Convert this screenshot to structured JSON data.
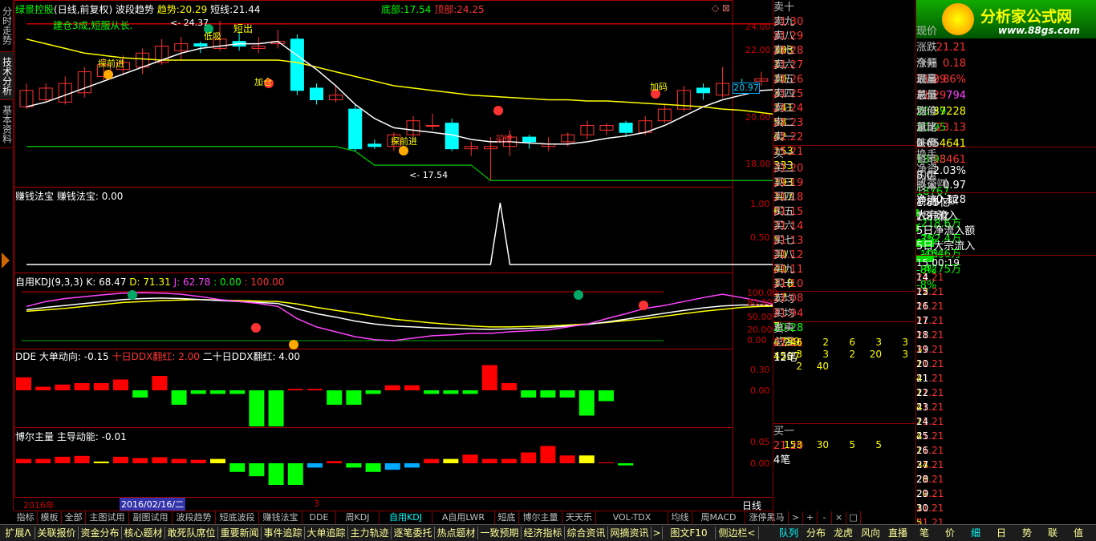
{
  "left_tabs": [
    "分时走势",
    "技术分析",
    "基本资料"
  ],
  "main": {
    "title_stock": "绿景控股",
    "title_mode": "(日线,前复权)",
    "title_ind": "波段趋势",
    "trend_label": "趋势:",
    "trend_val": "20.29",
    "short_label": "短线:",
    "short_val": "21.44",
    "bottom_label": "底部:",
    "bottom_val": "17.54",
    "top_label": "顶部:",
    "top_val": "24.25",
    "note": "建仓3成,短服从长.",
    "high_mark": "24.37",
    "low_mark": "17.54",
    "sig_short_out": "短出",
    "sig_buy": "低吸",
    "sig_early_in": "探前进",
    "sig_early_in2": "探前进",
    "sig_add": "加仓",
    "sig_in2": "买进",
    "sig_dyn": "加码",
    "axis": [
      "24.00",
      "22.00",
      "20.00",
      "18.00"
    ],
    "price_marker": "20.97"
  },
  "zqfb": {
    "title": "赚钱法宝",
    "label": "赚钱法宝:",
    "val": "0.00",
    "axis": [
      "1.00",
      "0.50"
    ]
  },
  "kdj": {
    "title": "自用KDJ(9,3,3)",
    "k": "K: 68.47",
    "d": "D: 71.31",
    "j": "J: 62.78",
    "v1": ": 0.00",
    "v2": ": 100.00",
    "axis": [
      "100.00",
      "80.00",
      "50.00",
      "20.00",
      "0.00"
    ]
  },
  "dde": {
    "title": "DDE",
    "l1": "大单动向: -0.15",
    "l2": "十日DDX翻红: 2.00",
    "l3": "二十日DDX翻红: 4.00",
    "axis": [
      "0.30",
      "0.00"
    ]
  },
  "boer": {
    "title": "博尔主量",
    "l1": "主导动能: -0.01",
    "axis": [
      "0.05",
      "0.00"
    ]
  },
  "dates": {
    "d1": "2016年",
    "d2": "2016/02/16/二",
    "d3": "3",
    "period": "日线"
  },
  "asks": [
    {
      "label": "卖十",
      "price": "21.30",
      "vol": "183",
      "arrow": "⇞"
    },
    {
      "label": "卖九",
      "price": "21.29",
      "vol": "30"
    },
    {
      "label": "卖八",
      "price": "21.28",
      "vol": "11"
    },
    {
      "label": "卖七",
      "price": "21.27",
      "vol": "10"
    },
    {
      "label": "卖六",
      "price": "21.26",
      "vol": "3"
    },
    {
      "label": "卖五",
      "price": "21.25",
      "vol": "141"
    },
    {
      "label": "卖四",
      "price": "21.24",
      "vol": "58"
    },
    {
      "label": "卖三",
      "price": "21.23",
      "vol": "42"
    },
    {
      "label": "卖二",
      "price": "21.22",
      "vol": "153"
    },
    {
      "label": "卖一",
      "price": "21.21",
      "vol": "333"
    }
  ],
  "bids": [
    {
      "label": "买一",
      "price": "21.20",
      "vol": "193"
    },
    {
      "label": "买二",
      "price": "21.19",
      "vol": "107"
    },
    {
      "label": "买三",
      "price": "21.18",
      "vol": "61"
    },
    {
      "label": "买四",
      "price": "21.15",
      "vol": "21"
    },
    {
      "label": "买五",
      "price": "21.14",
      "vol": "5"
    },
    {
      "label": "买六",
      "price": "21.13",
      "vol": "20"
    },
    {
      "label": "买七",
      "price": "21.12",
      "vol": "40"
    },
    {
      "label": "买八",
      "price": "21.11",
      "vol": "118"
    },
    {
      "label": "买九",
      "price": "21.10",
      "vol": "17"
    },
    {
      "label": "买十",
      "price": "21.08",
      "vol": "7",
      "arrow": "⇟"
    }
  ],
  "avg": {
    "sell_avg_l": "卖均",
    "sell_avg": "21.94",
    "total_sell_l": "总卖",
    "total_sell": "4739",
    "buy_avg_l": "买均",
    "buy_avg": "20.28",
    "total_buy_l": "总买",
    "total_buy": "4507"
  },
  "sell1q": {
    "label": "卖一",
    "price": "21.21",
    "count": "12笔",
    "rows": [
      [
        "246",
        "2",
        "6",
        "3",
        "3"
      ],
      [
        "3",
        "3",
        "2",
        "20",
        "3"
      ],
      [
        "2",
        "40",
        "",
        "",
        ""
      ]
    ]
  },
  "buy1q": {
    "label": "买一",
    "price": "21.20",
    "count": "4笔",
    "rows": [
      [
        "153",
        "30",
        "5",
        "5"
      ]
    ]
  },
  "logo": {
    "text": "分析家公式网",
    "url": "www.88gs.com"
  },
  "info": [
    {
      "l": "现价",
      "v": "21.21",
      "l2": "今开",
      "v2": "21.29"
    },
    {
      "l": "涨跌",
      "v": "0.18",
      "l2": "最高",
      "v2": "21.29"
    },
    {
      "l": "涨幅",
      "v": "0.86%",
      "l2": "最低",
      "v2": "20.59"
    },
    {
      "l": "现量",
      "v": "794",
      "l2": "均价",
      "v2": "20.95"
    },
    {
      "l": "总量",
      "v": "37228",
      "l2": "量比",
      "v2": "0.65"
    },
    {
      "l": "涨停",
      "v": "23.13",
      "l2": "跌停",
      "v2": "18.93"
    },
    {
      "l": "总笔",
      "v": "4641",
      "l2": "每笔",
      "v2": "8.0"
    },
    {
      "l": "外盘",
      "v": "18461",
      "l2": "内盘",
      "v2": "18767"
    }
  ],
  "info2": [
    {
      "l": "换手",
      "v": "2.03%",
      "l2": "股本",
      "v2": "1.85亿"
    },
    {
      "l": "净资",
      "v": "0.97",
      "l2": "流通",
      "v2": "1.83亿"
    },
    {
      "l": "收益㈣",
      "v": "-0.128",
      "l2": "PE(动)",
      "v2": ""
    }
  ],
  "flow": [
    {
      "l": "净流入额",
      "v": "-218.6万",
      "p": "-3%"
    },
    {
      "l": "大宗流入",
      "v": "-752.4万",
      "p": "-10%"
    },
    {
      "l": "5日净流入额",
      "v": "-4646万",
      "p": "-8%"
    },
    {
      "l": "5日大宗流入",
      "v": "-4275万",
      "p": "-8%"
    }
  ],
  "ticks": [
    {
      "t": "15:00:19",
      "p": "21.21",
      "v": "22"
    },
    {
      "t": "14",
      "p": "21.21",
      "v": "2"
    },
    {
      "t": "15",
      "p": "21.21",
      "v": "1"
    },
    {
      "t": "16",
      "p": "21.21",
      "v": "1"
    },
    {
      "t": "17",
      "p": "21.21",
      "v": "3"
    },
    {
      "t": "18",
      "p": "21.21",
      "v": "1"
    },
    {
      "t": "19",
      "p": "21.21",
      "v": "4"
    },
    {
      "t": "20",
      "p": "21.21",
      "v": "1"
    },
    {
      "t": "21",
      "p": "21.21",
      "v": "4"
    },
    {
      "t": "22",
      "p": "21.21",
      "v": "1"
    },
    {
      "t": "23",
      "p": "21.21",
      "v": "4"
    },
    {
      "t": "24",
      "p": "21.21",
      "v": "1"
    },
    {
      "t": "25",
      "p": "21.21",
      "v": "34"
    },
    {
      "t": "26",
      "p": "21.21",
      "v": "20"
    },
    {
      "t": "27",
      "p": "21.21",
      "v": "20"
    },
    {
      "t": "28",
      "p": "21.21",
      "v": "1"
    },
    {
      "t": "29",
      "p": "21.21",
      "v": "5"
    },
    {
      "t": "30",
      "p": "21.21",
      "v": "20"
    }
  ],
  "bottom_tabs": [
    "指标",
    "模板",
    "全部",
    "主图试用",
    "副图试用",
    "波段趋势",
    "短底波段",
    "赚钱法宝",
    "DDE",
    "周KDJ",
    "自用KDJ",
    "A自用LWR",
    "短底",
    "博尔主量",
    "天天乐",
    "VOL-TDX",
    "均线",
    "周MACD",
    "涨停黑马",
    ">",
    "+",
    "-",
    "×",
    "□"
  ],
  "status_items": [
    "扩展Λ",
    "关联报价",
    "资金分布",
    "核心题材",
    "敢死队席位",
    "重要新闻",
    "事件追踪",
    "大单追踪",
    "主力轨迹",
    "逐笔委托",
    "热点题材",
    "一致预期",
    "经济指标",
    "综合资讯",
    "网摘资讯",
    ">",
    "图文F10",
    "侧边栏<"
  ],
  "status_right": [
    "队列",
    "分布",
    "龙虎",
    "风向",
    "直播",
    "笔",
    "价",
    "细",
    "日",
    "势",
    "联",
    "值",
    "筹"
  ],
  "colors": {
    "up": "#ff3333",
    "down": "#00ffff",
    "grid": "#aa0000",
    "bg": "#000000",
    "trend": "#ffff00",
    "short": "#ffffff"
  },
  "chart_data": {
    "type": "candlestick",
    "candles": [
      {
        "o": 20.7,
        "c": 21.4,
        "h": 21.7,
        "l": 20.6
      },
      {
        "o": 21.0,
        "c": 21.5,
        "h": 21.7,
        "l": 20.9
      },
      {
        "o": 20.9,
        "c": 21.7,
        "h": 22.0,
        "l": 20.8
      },
      {
        "o": 21.3,
        "c": 22.2,
        "h": 22.4,
        "l": 21.1
      },
      {
        "o": 22.0,
        "c": 22.5,
        "h": 22.8,
        "l": 21.8
      },
      {
        "o": 22.3,
        "c": 22.6,
        "h": 22.9,
        "l": 22.1
      },
      {
        "o": 22.4,
        "c": 23.0,
        "h": 23.2,
        "l": 22.1
      },
      {
        "o": 22.6,
        "c": 23.3,
        "h": 23.6,
        "l": 22.5
      },
      {
        "o": 23.1,
        "c": 23.4,
        "h": 23.7,
        "l": 22.7
      },
      {
        "o": 23.4,
        "c": 23.3,
        "h": 23.5,
        "l": 23.0
      },
      {
        "o": 23.2,
        "c": 23.6,
        "h": 24.37,
        "l": 23.1
      },
      {
        "o": 23.5,
        "c": 23.3,
        "h": 23.9,
        "l": 23.1
      },
      {
        "o": 23.2,
        "c": 23.3,
        "h": 23.7,
        "l": 23.0
      },
      {
        "o": 23.4,
        "c": 23.5,
        "h": 24.0,
        "l": 23.2
      },
      {
        "o": 23.6,
        "c": 21.4,
        "h": 23.8,
        "l": 21.2
      },
      {
        "o": 21.5,
        "c": 21.0,
        "h": 21.7,
        "l": 20.8
      },
      {
        "o": 21.0,
        "c": 21.2,
        "h": 21.6,
        "l": 20.9
      },
      {
        "o": 20.6,
        "c": 18.9,
        "h": 20.8,
        "l": 18.8
      },
      {
        "o": 19.1,
        "c": 19.0,
        "h": 19.3,
        "l": 18.9
      },
      {
        "o": 19.0,
        "c": 19.5,
        "h": 19.6,
        "l": 18.8
      },
      {
        "o": 19.5,
        "c": 20.1,
        "h": 20.3,
        "l": 19.4
      },
      {
        "o": 19.9,
        "c": 19.9,
        "h": 20.4,
        "l": 19.7
      },
      {
        "o": 20.0,
        "c": 18.9,
        "h": 20.2,
        "l": 18.8
      },
      {
        "o": 18.9,
        "c": 19.0,
        "h": 19.2,
        "l": 18.6
      },
      {
        "o": 18.9,
        "c": 19.0,
        "h": 19.4,
        "l": 17.54
      },
      {
        "o": 19.0,
        "c": 19.4,
        "h": 19.7,
        "l": 18.6
      },
      {
        "o": 19.4,
        "c": 19.2,
        "h": 19.5,
        "l": 18.9
      },
      {
        "o": 19.0,
        "c": 19.1,
        "h": 19.4,
        "l": 18.8
      },
      {
        "o": 19.2,
        "c": 19.5,
        "h": 19.6,
        "l": 19.0
      },
      {
        "o": 19.5,
        "c": 19.9,
        "h": 20.1,
        "l": 19.3
      },
      {
        "o": 19.7,
        "c": 19.9,
        "h": 20.0,
        "l": 19.5
      },
      {
        "o": 20.0,
        "c": 19.6,
        "h": 20.1,
        "l": 19.4
      },
      {
        "o": 19.6,
        "c": 20.1,
        "h": 20.3,
        "l": 19.5
      },
      {
        "o": 20.1,
        "c": 20.6,
        "h": 20.8,
        "l": 20.0
      },
      {
        "o": 20.6,
        "c": 21.4,
        "h": 21.6,
        "l": 20.5
      },
      {
        "o": 21.5,
        "c": 21.3,
        "h": 21.7,
        "l": 21.0
      },
      {
        "o": 21.2,
        "c": 21.7,
        "h": 22.4,
        "l": 21.1
      },
      {
        "o": 21.7,
        "c": 21.6,
        "h": 21.9,
        "l": 21.4
      },
      {
        "o": 21.8,
        "c": 21.9,
        "h": 22.2,
        "l": 21.6
      },
      {
        "o": 21.6,
        "c": 21.1,
        "h": 21.8,
        "l": 21.0
      },
      {
        "o": 20.8,
        "c": 21.2,
        "h": 21.4,
        "l": 20.6
      }
    ],
    "trend": [
      23.6,
      23.4,
      23.2,
      23.0,
      22.9,
      22.8,
      22.75,
      22.7,
      22.7,
      22.7,
      22.7,
      22.7,
      22.7,
      22.7,
      22.6,
      22.4,
      22.2,
      22.0,
      21.8,
      21.6,
      21.5,
      21.4,
      21.3,
      21.2,
      21.15,
      21.1,
      21.05,
      21.0,
      21.0,
      20.95,
      20.95,
      20.9,
      20.85,
      20.8,
      20.75,
      20.7,
      20.6,
      20.55,
      20.45,
      20.35,
      20.29
    ],
    "short": [
      20.7,
      20.9,
      21.2,
      21.5,
      21.8,
      22.1,
      22.4,
      22.7,
      23.0,
      23.2,
      23.3,
      23.4,
      23.4,
      23.5,
      22.9,
      22.3,
      21.6,
      20.8,
      20.2,
      19.8,
      19.7,
      19.6,
      19.5,
      19.3,
      19.2,
      19.2,
      19.15,
      19.1,
      19.1,
      19.2,
      19.35,
      19.45,
      19.6,
      19.9,
      20.3,
      20.7,
      21.0,
      21.2,
      21.4,
      21.45,
      21.44
    ],
    "bottom": [
      19.0,
      19.0,
      19.0,
      19.0,
      19.0,
      19.0,
      19.0,
      19.0,
      19.0,
      19.0,
      19.0,
      19.0,
      19.0,
      19.0,
      19.0,
      19.0,
      19.0,
      18.8,
      18.2,
      18.2,
      18.2,
      18.2,
      18.2,
      18.2,
      17.54,
      17.54,
      17.54,
      17.54,
      17.54,
      17.54,
      17.54,
      17.54,
      17.54,
      17.54,
      17.54,
      17.54,
      17.54,
      17.54,
      17.54,
      17.54,
      17.54
    ],
    "top": [
      24.25,
      24.25,
      24.25,
      24.25,
      24.25,
      24.25,
      24.25,
      24.25,
      24.25,
      24.25,
      24.25,
      24.25,
      24.25,
      24.25,
      24.25,
      24.25,
      24.25,
      24.25,
      24.25,
      24.25,
      24.25,
      24.25,
      24.25,
      24.25,
      24.25,
      24.25,
      24.25,
      24.25,
      24.25,
      24.25,
      24.25,
      24.25,
      24.25,
      24.25,
      24.25,
      24.25,
      24.25,
      24.25,
      24.25,
      24.25,
      24.25
    ],
    "zqfb": [
      0,
      0,
      0,
      0,
      0,
      0,
      0,
      0,
      0,
      0,
      0,
      0,
      0,
      0,
      0,
      0,
      0,
      0,
      0,
      0,
      0,
      0,
      0,
      0,
      0,
      0,
      0,
      0,
      0,
      0,
      0,
      0,
      0,
      0,
      0,
      0,
      0,
      0,
      0,
      0,
      0
    ],
    "zqfb_peak": {
      "index": 24,
      "value": 1.0
    },
    "kdj_k": [
      63,
      68,
      72,
      76,
      80,
      84,
      86,
      87,
      86,
      84,
      82,
      80,
      78,
      76,
      65,
      55,
      48,
      40,
      34,
      30,
      28,
      26,
      25,
      24,
      23,
      24,
      25,
      27,
      30,
      33,
      38,
      44,
      50,
      56,
      62,
      67,
      71,
      73,
      73,
      72,
      70
    ],
    "kdj_d": [
      60,
      63,
      66,
      70,
      74,
      78,
      80,
      82,
      83,
      84,
      83,
      82,
      81,
      80,
      75,
      68,
      62,
      56,
      50,
      44,
      40,
      36,
      33,
      30,
      28,
      28,
      29,
      30,
      32,
      34,
      37,
      41,
      45,
      50,
      55,
      60,
      64,
      68,
      70,
      71,
      71
    ],
    "kdj_j": [
      70,
      80,
      86,
      90,
      94,
      97,
      98,
      97,
      95,
      90,
      84,
      80,
      76,
      70,
      45,
      28,
      18,
      8,
      2,
      0,
      5,
      10,
      12,
      15,
      15,
      18,
      20,
      22,
      28,
      34,
      45,
      55,
      66,
      72,
      80,
      88,
      95,
      88,
      80,
      72,
      63
    ],
    "dde": [
      0.18,
      0.05,
      0.08,
      0.1,
      0.1,
      0.15,
      -0.1,
      0.2,
      -0.2,
      -0.05,
      -0.05,
      -0.05,
      -0.5,
      -0.5,
      0.02,
      0.02,
      -0.2,
      -0.2,
      -0.05,
      0.07,
      0.07,
      -0.05,
      -0.05,
      -0.05,
      0.35,
      0.1,
      -0.1,
      -0.1,
      -0.1,
      -0.35,
      -0.15
    ],
    "boer": [
      0.01,
      0.01,
      0.015,
      0.017,
      0.004,
      0.015,
      0.012,
      0.014,
      0.01,
      0.008,
      0.01,
      -0.02,
      -0.03,
      -0.05,
      -0.05,
      -0.01,
      0.005,
      -0.01,
      -0.02,
      -0.015,
      -0.01,
      0.01,
      0.01,
      0.02,
      0.01,
      0.01,
      0.025,
      0.04,
      0.018,
      0.018,
      0.002,
      -0.005
    ]
  }
}
